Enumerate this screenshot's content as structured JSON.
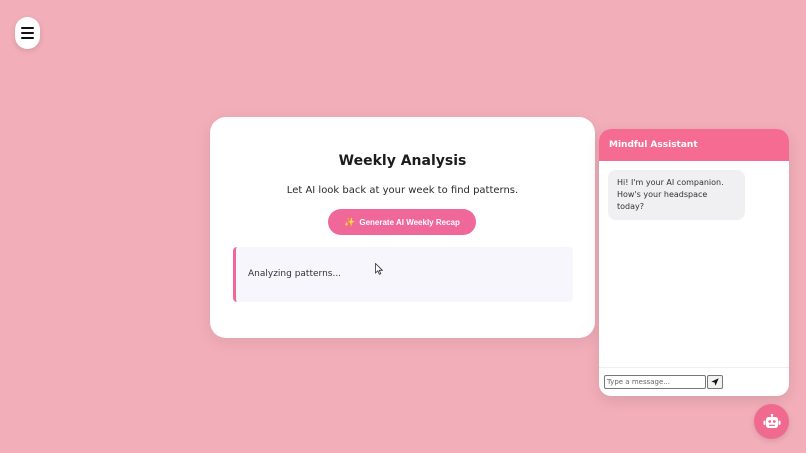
{
  "nav": {
    "menu_icon": "hamburger-icon"
  },
  "analysis": {
    "title": "Weekly Analysis",
    "subtitle": "Let AI look back at your week to find patterns.",
    "generate_button": {
      "icon": "sparkle-icon",
      "label": "Generate AI Weekly Recap"
    },
    "result_text": "Analyzing patterns..."
  },
  "chat": {
    "title": "Mindful Assistant",
    "messages": [
      {
        "from": "assistant",
        "text": "Hi! I'm your AI companion. How's your headspace today?"
      }
    ],
    "input": {
      "value": "",
      "placeholder": "Type a message..."
    },
    "send_icon": "send-icon"
  },
  "fab": {
    "icon": "robot-icon"
  },
  "colors": {
    "background": "#f2aeb9",
    "accent": "#f0679a",
    "chat_header": "#f56b92"
  }
}
